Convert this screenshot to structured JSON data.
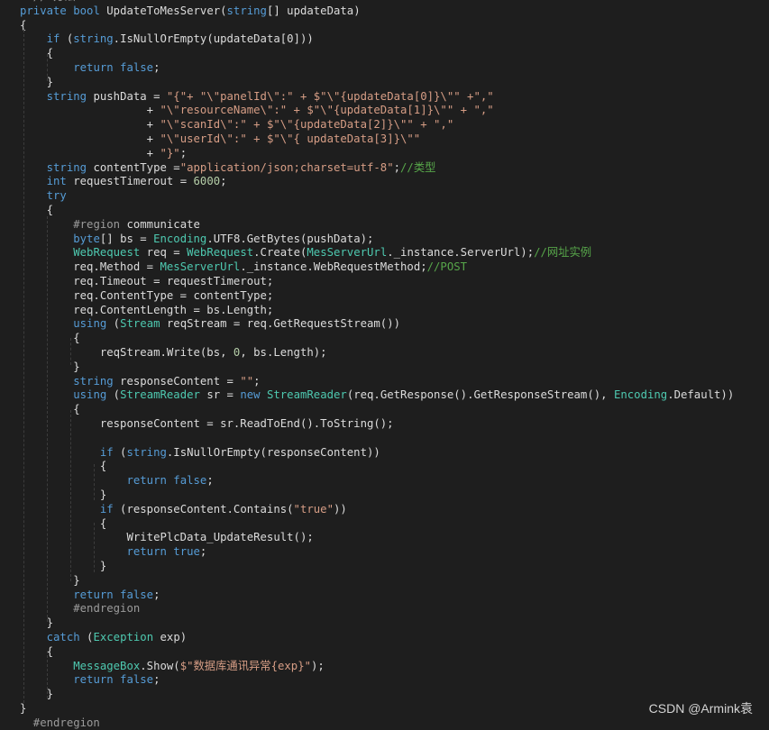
{
  "colors": {
    "background": "#1e1e1e",
    "keyword": "#569cd6",
    "type": "#4ec9b0",
    "string": "#d69d85",
    "comment": "#57a64a",
    "number": "#b5cea8",
    "default": "#dcdcdc"
  },
  "watermark": "CSDN @Armink袁",
  "code_lines": [
    [
      [
        "pp",
        "  // 方法"
      ]
    ],
    [
      [
        "kw",
        "private"
      ],
      [
        "",
        ""
      ],
      [
        "kw",
        " bool"
      ],
      [
        "",
        " UpdateToMesServer("
      ],
      [
        "kw",
        "string"
      ],
      [
        "",
        "[] updateData)"
      ]
    ],
    [
      [
        "",
        "{"
      ]
    ],
    [
      [
        "",
        "    "
      ],
      [
        "kw",
        "if"
      ],
      [
        "",
        " ("
      ],
      [
        "kw",
        "string"
      ],
      [
        "",
        ".IsNullOrEmpty(updateData[0]))"
      ]
    ],
    [
      [
        "",
        "    {"
      ]
    ],
    [
      [
        "",
        "        "
      ],
      [
        "kw",
        "return"
      ],
      [
        "kw",
        " false"
      ],
      [
        "",
        ";"
      ]
    ],
    [
      [
        "",
        "    }"
      ]
    ],
    [
      [
        "",
        "    "
      ],
      [
        "kw",
        "string"
      ],
      [
        "",
        " pushData = "
      ],
      [
        "st",
        "\"{\"+ \"\\\"panelId\\\":\" + $\"\\\"{updateData[0]}\\\"\" +\",\""
      ]
    ],
    [
      [
        "",
        "                   + "
      ],
      [
        "st",
        "\"\\\"resourceName\\\":\" + $\"\\\"{updateData[1]}\\\"\" + \",\""
      ]
    ],
    [
      [
        "",
        "                   + "
      ],
      [
        "st",
        "\"\\\"scanId\\\":\" + $\"\\\"{updateData[2]}\\\"\" + \",\""
      ]
    ],
    [
      [
        "",
        "                   + "
      ],
      [
        "st",
        "\"\\\"userId\\\":\" + $\"\\\"{ updateData[3]}\\\"\""
      ]
    ],
    [
      [
        "",
        "                   + "
      ],
      [
        "st",
        "\"}\""
      ],
      [
        "",
        ";"
      ]
    ],
    [
      [
        "",
        "    "
      ],
      [
        "kw",
        "string"
      ],
      [
        "",
        " contentType ="
      ],
      [
        "st",
        "\"application/json;charset=utf-8\""
      ],
      [
        "",
        ";"
      ],
      [
        "cm",
        "//类型"
      ]
    ],
    [
      [
        "",
        "    "
      ],
      [
        "kw",
        "int"
      ],
      [
        "",
        " requestTimerout = "
      ],
      [
        "nm",
        "6000"
      ],
      [
        "",
        ";"
      ]
    ],
    [
      [
        "",
        "    "
      ],
      [
        "kw",
        "try"
      ]
    ],
    [
      [
        "",
        "    {"
      ]
    ],
    [
      [
        "",
        "        "
      ],
      [
        "pp",
        "#region"
      ],
      [
        "",
        " communicate"
      ]
    ],
    [
      [
        "",
        "        "
      ],
      [
        "kw",
        "byte"
      ],
      [
        "",
        "[] bs = "
      ],
      [
        "ty",
        "Encoding"
      ],
      [
        "",
        ".UTF8.GetBytes(pushData);"
      ]
    ],
    [
      [
        "",
        "        "
      ],
      [
        "ty",
        "WebRequest"
      ],
      [
        "",
        " req = "
      ],
      [
        "ty",
        "WebRequest"
      ],
      [
        "",
        ".Create("
      ],
      [
        "ty",
        "MesServerUrl"
      ],
      [
        "",
        "._instance.ServerUrl);"
      ],
      [
        "cm",
        "//网址实例"
      ]
    ],
    [
      [
        "",
        "        req.Method = "
      ],
      [
        "ty",
        "MesServerUrl"
      ],
      [
        "",
        "._instance.WebRequestMethod;"
      ],
      [
        "cm",
        "//POST"
      ]
    ],
    [
      [
        "",
        "        req.Timeout = requestTimerout;"
      ]
    ],
    [
      [
        "",
        "        req.ContentType = contentType;"
      ]
    ],
    [
      [
        "",
        "        req.ContentLength = bs.Length;"
      ]
    ],
    [
      [
        "",
        "        "
      ],
      [
        "kw",
        "using"
      ],
      [
        "",
        " ("
      ],
      [
        "ty",
        "Stream"
      ],
      [
        "",
        " reqStream = req.GetRequestStream())"
      ]
    ],
    [
      [
        "",
        "        {"
      ]
    ],
    [
      [
        "",
        "            reqStream.Write(bs, "
      ],
      [
        "nm",
        "0"
      ],
      [
        "",
        ", bs.Length);"
      ]
    ],
    [
      [
        "",
        "        }"
      ]
    ],
    [
      [
        "",
        "        "
      ],
      [
        "kw",
        "string"
      ],
      [
        "",
        " responseContent = "
      ],
      [
        "st",
        "\"\""
      ],
      [
        "",
        ";"
      ]
    ],
    [
      [
        "",
        "        "
      ],
      [
        "kw",
        "using"
      ],
      [
        "",
        " ("
      ],
      [
        "ty",
        "StreamReader"
      ],
      [
        "",
        " sr = "
      ],
      [
        "kw",
        "new"
      ],
      [
        "",
        " "
      ],
      [
        "ty",
        "StreamReader"
      ],
      [
        "",
        "(req.GetResponse().GetResponseStream(), "
      ],
      [
        "ty",
        "Encoding"
      ],
      [
        "",
        ".Default))"
      ]
    ],
    [
      [
        "",
        "        {"
      ]
    ],
    [
      [
        "",
        "            responseContent = sr.ReadToEnd().ToString();"
      ]
    ],
    [
      [
        "",
        ""
      ]
    ],
    [
      [
        "",
        "            "
      ],
      [
        "kw",
        "if"
      ],
      [
        "",
        " ("
      ],
      [
        "kw",
        "string"
      ],
      [
        "",
        ".IsNullOrEmpty(responseContent))"
      ]
    ],
    [
      [
        "",
        "            {"
      ]
    ],
    [
      [
        "",
        "                "
      ],
      [
        "kw",
        "return"
      ],
      [
        "kw",
        " false"
      ],
      [
        "",
        ";"
      ]
    ],
    [
      [
        "",
        "            }"
      ]
    ],
    [
      [
        "",
        "            "
      ],
      [
        "kw",
        "if"
      ],
      [
        "",
        " (responseContent.Contains("
      ],
      [
        "st",
        "\"true\""
      ],
      [
        "",
        "))"
      ]
    ],
    [
      [
        "",
        "            {"
      ]
    ],
    [
      [
        "",
        "                WritePlcData_UpdateResult();"
      ]
    ],
    [
      [
        "",
        "                "
      ],
      [
        "kw",
        "return"
      ],
      [
        "kw",
        " true"
      ],
      [
        "",
        ";"
      ]
    ],
    [
      [
        "",
        "            }"
      ]
    ],
    [
      [
        "",
        "        }"
      ]
    ],
    [
      [
        "",
        "        "
      ],
      [
        "kw",
        "return"
      ],
      [
        "kw",
        " false"
      ],
      [
        "",
        ";"
      ]
    ],
    [
      [
        "",
        "        "
      ],
      [
        "pp",
        "#endregion"
      ]
    ],
    [
      [
        "",
        "    }"
      ]
    ],
    [
      [
        "",
        "    "
      ],
      [
        "kw",
        "catch"
      ],
      [
        "",
        " ("
      ],
      [
        "ty",
        "Exception"
      ],
      [
        "",
        " exp)"
      ]
    ],
    [
      [
        "",
        "    {"
      ]
    ],
    [
      [
        "",
        "        "
      ],
      [
        "ty",
        "MessageBox"
      ],
      [
        "",
        ".Show("
      ],
      [
        "st",
        "$\"数据库通讯异常{exp}\""
      ],
      [
        "",
        ");"
      ]
    ],
    [
      [
        "",
        "        "
      ],
      [
        "kw",
        "return"
      ],
      [
        "kw",
        " false"
      ],
      [
        "",
        ";"
      ]
    ],
    [
      [
        "",
        "    }"
      ]
    ],
    [
      [
        "",
        "}"
      ]
    ],
    [
      [
        "pp",
        "  #endregion"
      ]
    ]
  ]
}
